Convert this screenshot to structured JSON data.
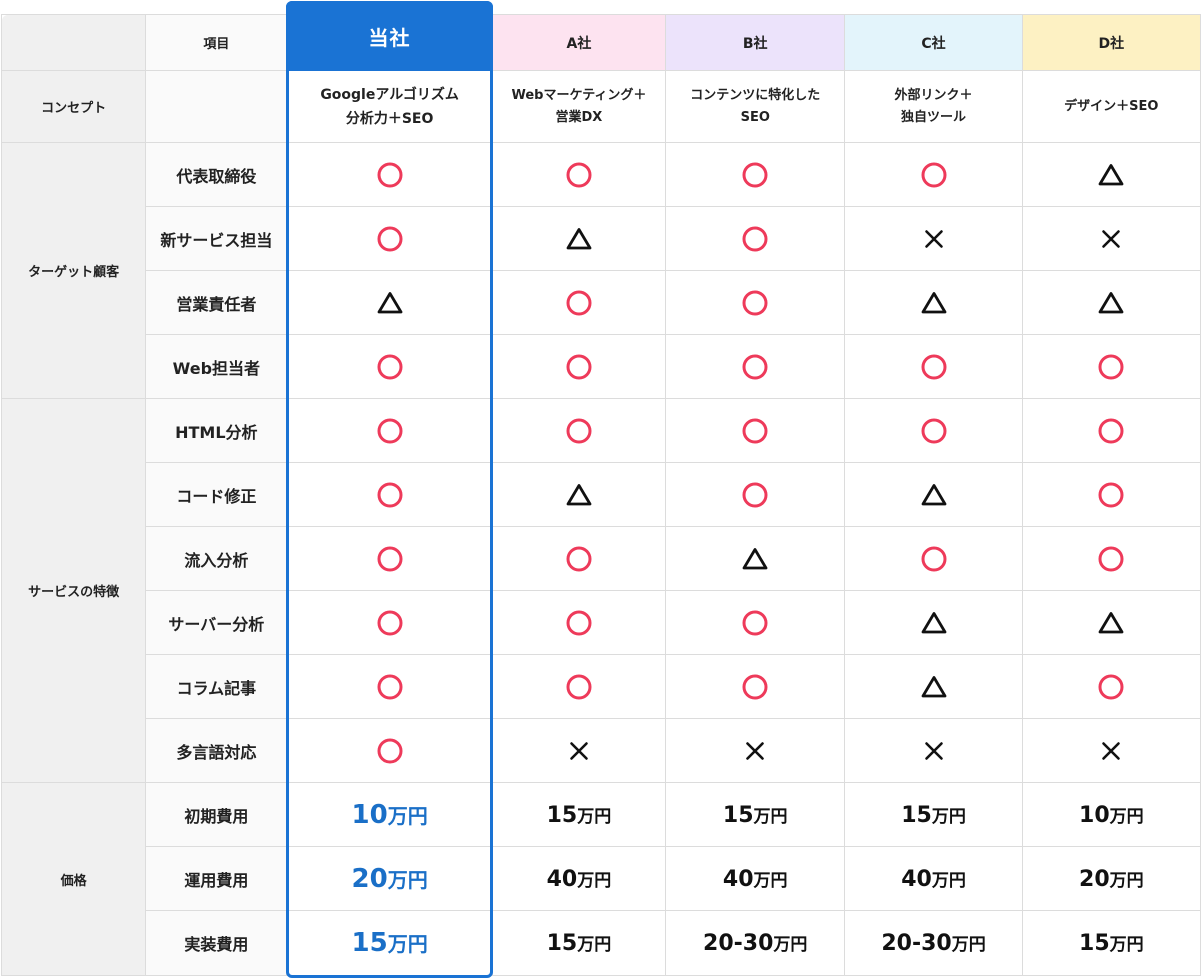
{
  "header": {
    "item": "項目",
    "us": "当社",
    "a": "A社",
    "b": "B社",
    "c": "C社",
    "d": "D社"
  },
  "concept": {
    "label": "コンセプト",
    "us_line1": "Googleアルゴリズム",
    "us_line2": "分析力＋SEO",
    "a_line1": "Webマーケティング＋",
    "a_line2": "営業DX",
    "b_line1": "コンテンツに特化した",
    "b_line2": "SEO",
    "c_line1": "外部リンク＋",
    "c_line2": "独自ツール",
    "d": "デザイン＋SEO"
  },
  "categories": {
    "target": "ターゲット顧客",
    "features": "サービスの特徴",
    "price": "価格"
  },
  "rows": [
    {
      "item": "代表取締役",
      "values": [
        "circle",
        "circle",
        "circle",
        "circle",
        "triangle"
      ]
    },
    {
      "item": "新サービス担当",
      "values": [
        "circle",
        "triangle",
        "circle",
        "cross",
        "cross"
      ]
    },
    {
      "item": "営業責任者",
      "values": [
        "triangle",
        "circle",
        "circle",
        "triangle",
        "triangle"
      ]
    },
    {
      "item": "Web担当者",
      "values": [
        "circle",
        "circle",
        "circle",
        "circle",
        "circle"
      ]
    },
    {
      "item": "HTML分析",
      "values": [
        "circle",
        "circle",
        "circle",
        "circle",
        "circle"
      ]
    },
    {
      "item": "コード修正",
      "values": [
        "circle",
        "triangle",
        "circle",
        "triangle",
        "circle"
      ]
    },
    {
      "item": "流入分析",
      "values": [
        "circle",
        "circle",
        "triangle",
        "circle",
        "circle"
      ]
    },
    {
      "item": "サーバー分析",
      "values": [
        "circle",
        "circle",
        "circle",
        "triangle",
        "triangle"
      ]
    },
    {
      "item": "コラム記事",
      "values": [
        "circle",
        "circle",
        "circle",
        "triangle",
        "circle"
      ]
    },
    {
      "item": "多言語対応",
      "values": [
        "circle",
        "cross",
        "cross",
        "cross",
        "cross"
      ]
    }
  ],
  "prices": [
    {
      "item": "初期費用",
      "values": [
        "10",
        "15",
        "15",
        "15",
        "10"
      ]
    },
    {
      "item": "運用費用",
      "values": [
        "20",
        "40",
        "40",
        "40",
        "20"
      ]
    },
    {
      "item": "実装費用",
      "values": [
        "15",
        "15",
        "20-30",
        "20-30",
        "15"
      ]
    }
  ],
  "price_unit": "万円",
  "colors": {
    "accent": "#1a73d4",
    "circle": "#ee3a5a",
    "mark": "#111111"
  },
  "icons": {
    "circle": "circle-icon",
    "triangle": "triangle-icon",
    "cross": "cross-icon"
  }
}
